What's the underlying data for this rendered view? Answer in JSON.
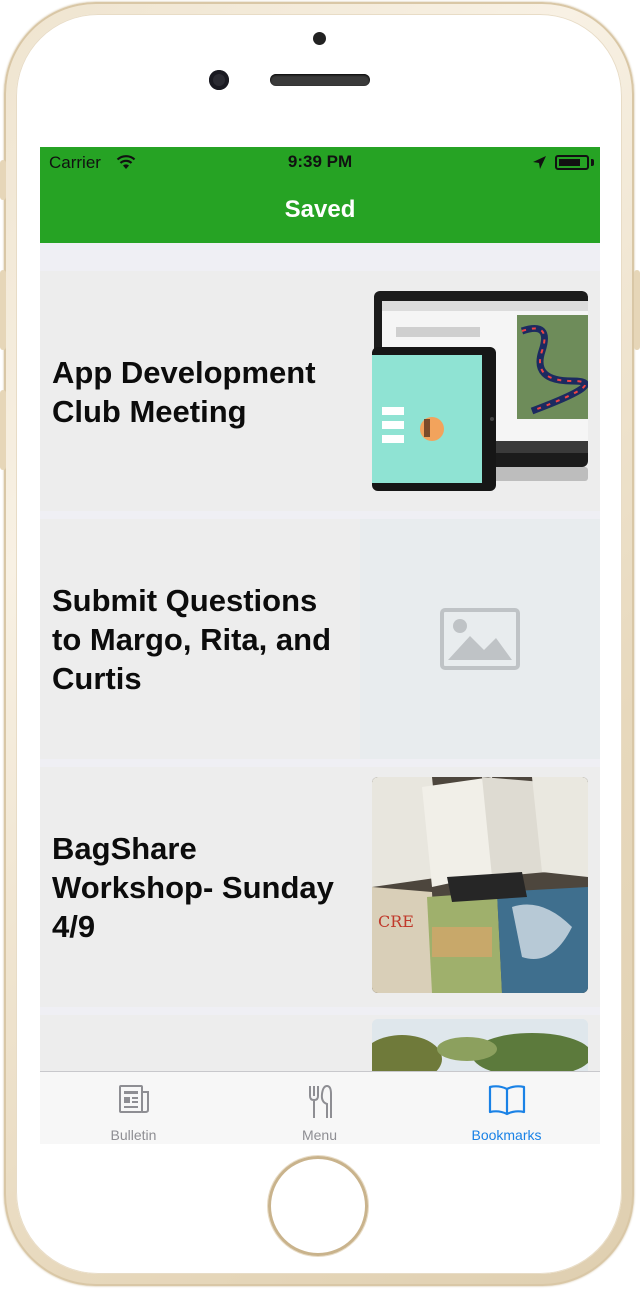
{
  "status_bar": {
    "carrier": "Carrier",
    "time": "9:39 PM",
    "icons": [
      "wifi-icon",
      "location-icon",
      "battery-icon"
    ]
  },
  "nav_bar": {
    "title": "Saved"
  },
  "items": [
    {
      "title": "App Development Club Meeting",
      "thumbnail": "laptop-and-tablet-photo"
    },
    {
      "title": "Submit Questions to Margo, Rita, and Curtis",
      "thumbnail": "image-placeholder-icon"
    },
    {
      "title": "BagShare Workshop- Sunday 4/9",
      "thumbnail": "tote-bags-photo"
    },
    {
      "title": "",
      "thumbnail": "trees-photo"
    }
  ],
  "tab_bar": {
    "tabs": [
      {
        "label": "Bulletin",
        "icon": "newspaper-icon",
        "active": false
      },
      {
        "label": "Menu",
        "icon": "fork-knife-icon",
        "active": false
      },
      {
        "label": "Bookmarks",
        "icon": "book-icon",
        "active": true
      }
    ]
  },
  "colors": {
    "accent_green": "#26a324",
    "tab_active": "#1a82e6",
    "tab_inactive": "#8e8e93"
  }
}
